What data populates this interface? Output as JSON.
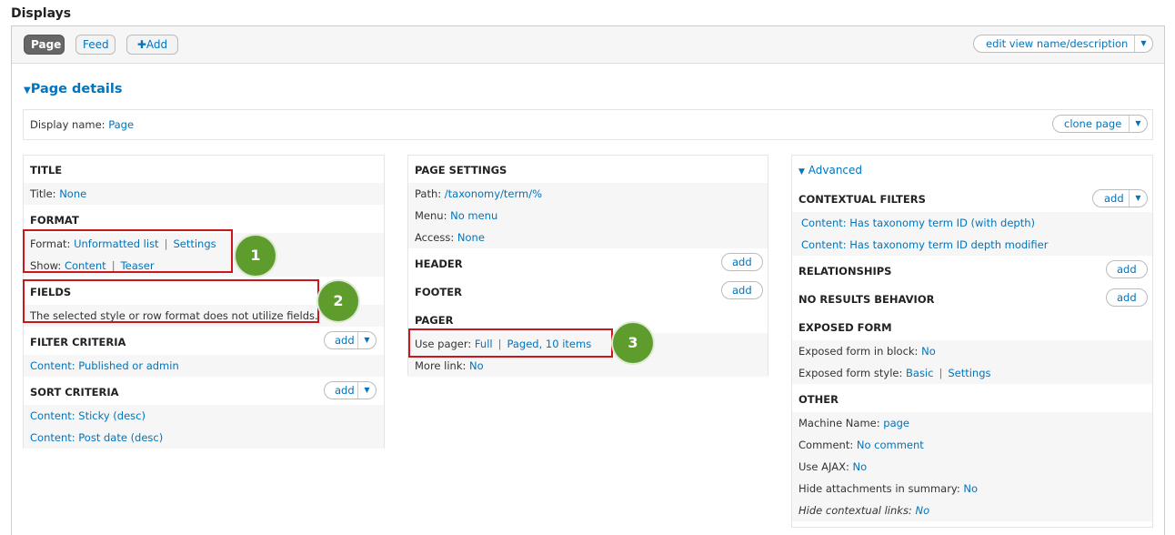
{
  "header": {
    "title": "Displays"
  },
  "tabs": [
    {
      "label": "Page"
    },
    {
      "label": "Feed"
    },
    {
      "label": "Add"
    }
  ],
  "edit_view_button": "edit view name/description",
  "section": {
    "title": "Page details"
  },
  "display_name": {
    "label": "Display name:",
    "value": "Page",
    "clone_button": "clone page"
  },
  "left": {
    "title_hdr": "TITLE",
    "title_label": "Title:",
    "title_value": "None",
    "format_hdr": "FORMAT",
    "format_label": "Format:",
    "format_value": "Unformatted list",
    "format_settings": "Settings",
    "show_label": "Show:",
    "show_value": "Content",
    "show_mode": "Teaser",
    "fields_hdr": "FIELDS",
    "fields_msg": "The selected style or row format does not utilize fields.",
    "filter_hdr": "FILTER CRITERIA",
    "filter_item": "Content: Published or admin",
    "sort_hdr": "SORT CRITERIA",
    "sort_item1": "Content: Sticky (desc)",
    "sort_item2": "Content: Post date (desc)",
    "add": "add"
  },
  "middle": {
    "settings_hdr": "PAGE SETTINGS",
    "path_label": "Path:",
    "path_value": "/taxonomy/term/%",
    "menu_label": "Menu:",
    "menu_value": "No menu",
    "access_label": "Access:",
    "access_value": "None",
    "header_hdr": "HEADER",
    "footer_hdr": "FOOTER",
    "pager_hdr": "PAGER",
    "pager_label": "Use pager:",
    "pager_value": "Full",
    "pager_items": "Paged, 10 items",
    "more_label": "More link:",
    "more_value": "No",
    "add": "add"
  },
  "right": {
    "advanced": "Advanced",
    "ctx_hdr": "CONTEXTUAL FILTERS",
    "ctx_item1": "Content: Has taxonomy term ID (with depth)",
    "ctx_item2": "Content: Has taxonomy term ID depth modifier",
    "rel_hdr": "RELATIONSHIPS",
    "nores_hdr": "NO RESULTS BEHAVIOR",
    "exposed_hdr": "EXPOSED FORM",
    "efb_label": "Exposed form in block:",
    "efb_value": "No",
    "efs_label": "Exposed form style:",
    "efs_value": "Basic",
    "efs_settings": "Settings",
    "other_hdr": "OTHER",
    "machine_label": "Machine Name:",
    "machine_value": "page",
    "comment_label": "Comment:",
    "comment_value": "No comment",
    "ajax_label": "Use AJAX:",
    "ajax_value": "No",
    "hide_att_label": "Hide attachments in summary:",
    "hide_att_value": "No",
    "hide_ctx_label": "Hide contextual links:",
    "hide_ctx_value": "No",
    "add": "add"
  },
  "callouts": [
    "1",
    "2",
    "3"
  ],
  "colors": {
    "link": "#0074bd",
    "callout": "#5e9c2e",
    "highlight": "#c9171d"
  }
}
